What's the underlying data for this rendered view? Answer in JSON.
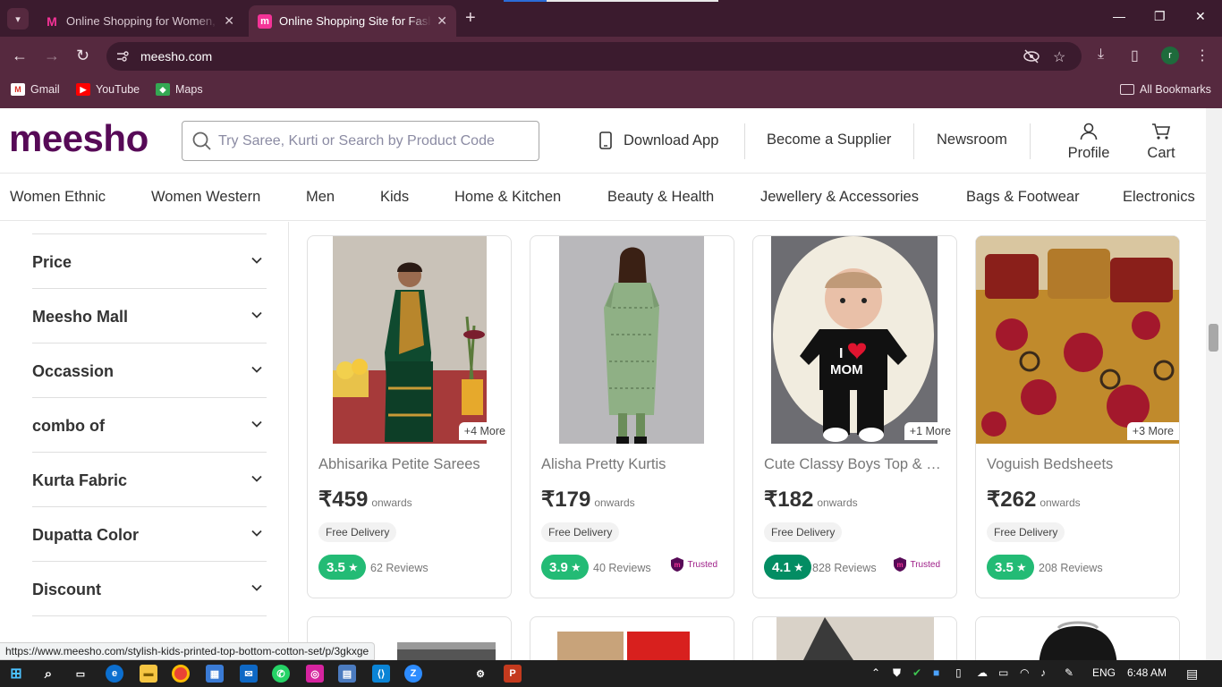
{
  "browser": {
    "tabs": [
      {
        "title": "Online Shopping for Women, M",
        "active": false
      },
      {
        "title": "Online Shopping Site for Fashio",
        "active": true
      }
    ],
    "url": "meesho.com",
    "profile_initial": "r",
    "bookmarks": [
      "Gmail",
      "YouTube",
      "Maps"
    ],
    "all_bookmarks": "All Bookmarks"
  },
  "site": {
    "logo": "meesho",
    "search_placeholder": "Try Saree, Kurti or Search by Product Code",
    "download_app": "Download App",
    "become_supplier": "Become a Supplier",
    "newsroom": "Newsroom",
    "profile": "Profile",
    "cart": "Cart",
    "brand_color": "#570a57",
    "accent_color": "#f43397"
  },
  "categories": [
    "Women Ethnic",
    "Women Western",
    "Men",
    "Kids",
    "Home & Kitchen",
    "Beauty & Health",
    "Jewellery & Accessories",
    "Bags & Footwear",
    "Electronics"
  ],
  "filters": [
    "Price",
    "Meesho Mall",
    "Occassion",
    "combo of",
    "Kurta Fabric",
    "Dupatta Color",
    "Discount"
  ],
  "products": [
    {
      "name": "Abhisarika Petite Sarees",
      "price": "₹459",
      "onwards": "onwards",
      "more": "+4 More",
      "delivery": "Free Delivery",
      "rating": "3.5",
      "reviews": "62 Reviews",
      "trusted": "",
      "rating_color": "#23bb75"
    },
    {
      "name": "Alisha Pretty Kurtis",
      "price": "₹179",
      "onwards": "onwards",
      "more": "",
      "delivery": "Free Delivery",
      "rating": "3.9",
      "reviews": "40 Reviews",
      "trusted": "Trusted",
      "rating_color": "#23bb75"
    },
    {
      "name": "Cute Classy Boys Top & Bottom Set",
      "price": "₹182",
      "onwards": "onwards",
      "more": "+1 More",
      "delivery": "Free Delivery",
      "rating": "4.1",
      "reviews": "828 Reviews",
      "trusted": "Trusted",
      "rating_color": "#038d63"
    },
    {
      "name": "Voguish Bedsheets",
      "price": "₹262",
      "onwards": "onwards",
      "more": "+3 More",
      "delivery": "Free Delivery",
      "rating": "3.5",
      "reviews": "208 Reviews",
      "trusted": "",
      "rating_color": "#23bb75"
    }
  ],
  "status_url": "https://www.meesho.com/stylish-kids-printed-top-bottom-cotton-set/p/3gkxge",
  "taskbar": {
    "language": "ENG",
    "time": "6:48 AM"
  }
}
